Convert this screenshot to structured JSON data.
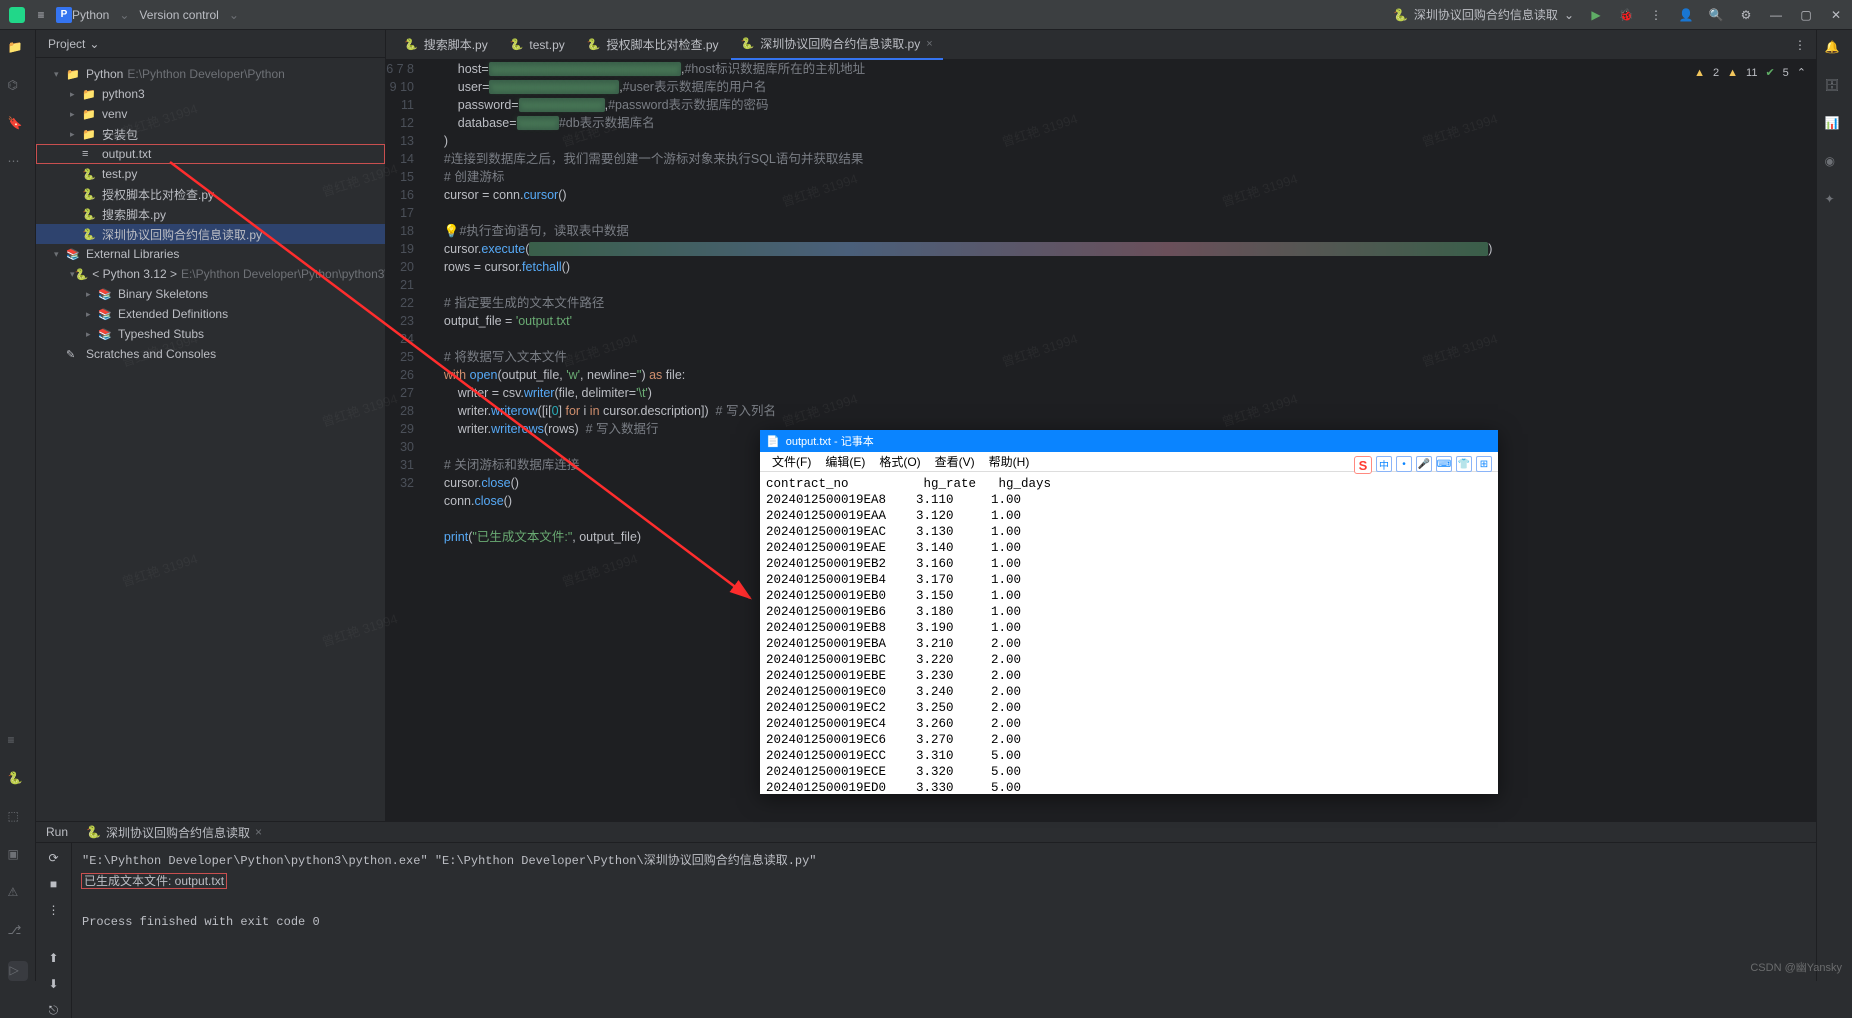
{
  "topbar": {
    "menu_icon": "≡",
    "project_badge": "P",
    "project_name": "Python",
    "vcs": "Version control",
    "run_config_icon": "▶",
    "run_config": "深圳协议回购合约信息读取",
    "icons": [
      "run",
      "debug",
      "more",
      "account",
      "search",
      "settings",
      "minimize",
      "maximize",
      "close"
    ]
  },
  "project": {
    "title": "Project",
    "tree": [
      {
        "ind": 0,
        "arrow": "▾",
        "icon": "📁",
        "label": "Python",
        "path": "E:\\Pyhthon Developer\\Python"
      },
      {
        "ind": 1,
        "arrow": "▸",
        "icon": "📁",
        "label": "python3",
        "color": "#3574f0"
      },
      {
        "ind": 1,
        "arrow": "▸",
        "icon": "📁",
        "label": "venv",
        "color": "#c88b4a"
      },
      {
        "ind": 1,
        "arrow": "▸",
        "icon": "📁",
        "label": "安装包"
      },
      {
        "ind": 1,
        "arrow": "",
        "icon": "≡",
        "label": "output.txt",
        "boxed": true
      },
      {
        "ind": 1,
        "arrow": "",
        "icon": "🐍",
        "label": "test.py"
      },
      {
        "ind": 1,
        "arrow": "",
        "icon": "🐍",
        "label": "授权脚本比对检查.py"
      },
      {
        "ind": 1,
        "arrow": "",
        "icon": "🐍",
        "label": "搜索脚本.py"
      },
      {
        "ind": 1,
        "arrow": "",
        "icon": "🐍",
        "label": "深圳协议回购合约信息读取.py",
        "sel": true
      },
      {
        "ind": 0,
        "arrow": "▾",
        "icon": "📚",
        "label": "External Libraries"
      },
      {
        "ind": 1,
        "arrow": "▾",
        "icon": "🐍",
        "label": "< Python 3.12 >",
        "path": "E:\\Pyhthon Developer\\Python\\python3\\pyth"
      },
      {
        "ind": 2,
        "arrow": "▸",
        "icon": "📚",
        "label": "Binary Skeletons"
      },
      {
        "ind": 2,
        "arrow": "▸",
        "icon": "📚",
        "label": "Extended Definitions"
      },
      {
        "ind": 2,
        "arrow": "▸",
        "icon": "📚",
        "label": "Typeshed Stubs"
      },
      {
        "ind": 0,
        "arrow": "",
        "icon": "✎",
        "label": "Scratches and Consoles"
      }
    ]
  },
  "tabs": [
    {
      "label": "搜索脚本.py"
    },
    {
      "label": "test.py"
    },
    {
      "label": "授权脚本比对检查.py"
    },
    {
      "label": "深圳协议回购合约信息读取.py",
      "active": true
    }
  ],
  "editor_status": {
    "err": "2",
    "warn": "11",
    "ok": "5"
  },
  "code_start_line": 6,
  "code_lines": [
    {
      "n": 6,
      "html": "        host=<span class='str blurred'>'xxxxxxxxxxxxxxxxxxxxxxxxxxxxxx'</span>,<span class='cm'>#host标识数据库所在的主机地址</span>"
    },
    {
      "n": 7,
      "html": "        user=<span class='str blurred'>'xxxxxxxxxxxxxxxxxxxx'</span>,<span class='cm'>#user表示数据库的用户名</span>"
    },
    {
      "n": 8,
      "html": "        password=<span class='str blurred'>'xxxxxxxxxxxxx'</span>,<span class='cm'>#password表示数据库的密码</span>"
    },
    {
      "n": 9,
      "html": "        database=<span class='str blurred'>'xxxxxx'</span><span class='cm'>#db表示数据库名</span>"
    },
    {
      "n": 10,
      "html": "    )"
    },
    {
      "n": 11,
      "html": "    <span class='cm'>#连接到数据库之后，我们需要创建一个游标对象来执行SQL语句并获取结果</span>"
    },
    {
      "n": 12,
      "html": "    <span class='cm'># 创建游标</span>"
    },
    {
      "n": 13,
      "html": "    cursor = conn.<span class='fn'>cursor</span>()"
    },
    {
      "n": 14,
      "html": ""
    },
    {
      "n": 15,
      "html": "    <span class='cm'>💡#执行查询语句，读取表中数据</span>"
    },
    {
      "n": 16,
      "html": "    cursor.<span class='fn'>execute</span>(<span class='str blurred2'>\"xxxxxxxxxxxxxxxxxxxxxxxxxxxxxxxxxxxxxxxxxxxxxxxxxxxxxxxxxxxxxxxxxxxxxxxxxxxxxxxxxxxxxxxxxxxxxxxxxxxxxxxxxxxxxxxxxxxxxxxxxxxxxxxxxxxxxxxxxxxxxxxxxxxxxxxx\"</span>)"
    },
    {
      "n": 17,
      "html": "    rows = cursor.<span class='fn'>fetchall</span>()"
    },
    {
      "n": 18,
      "html": ""
    },
    {
      "n": 19,
      "html": "    <span class='cm'># 指定要生成的文本文件路径</span>"
    },
    {
      "n": 20,
      "html": "    output_file = <span class='str'>'output.txt'</span>"
    },
    {
      "n": 21,
      "html": ""
    },
    {
      "n": 22,
      "html": "    <span class='cm'># 将数据写入文本文件</span>"
    },
    {
      "n": 23,
      "html": "    <span class='kw'>with</span> <span class='fn'>open</span>(output_file, <span class='str'>'w'</span>, newline=<span class='str'>''</span>) <span class='kw'>as</span> file:"
    },
    {
      "n": 24,
      "html": "        writer = csv.<span class='fn'>writer</span>(file, delimiter=<span class='str'>'\\t'</span>)"
    },
    {
      "n": 25,
      "html": "        writer.<span class='fn'>writerow</span>([i[<span class='num'>0</span>] <span class='kw'>for</span> i <span class='kw'>in</span> cursor.description])  <span class='cm'># 写入列名</span>"
    },
    {
      "n": 26,
      "html": "        writer.<span class='fn'>writerows</span>(rows)  <span class='cm'># 写入数据行</span>"
    },
    {
      "n": 27,
      "html": ""
    },
    {
      "n": 28,
      "html": "    <span class='cm'># 关闭游标和数据库连接</span>"
    },
    {
      "n": 29,
      "html": "    cursor.<span class='fn'>close</span>()"
    },
    {
      "n": 30,
      "html": "    conn.<span class='fn'>close</span>()"
    },
    {
      "n": 31,
      "html": ""
    },
    {
      "n": 32,
      "html": "    <span class='fn'>print</span>(<span class='str'>\"已生成文本文件:\"</span>, output_file)"
    }
  ],
  "run": {
    "title": "Run",
    "tab": "深圳协议回购合约信息读取",
    "lines": [
      "\"E:\\Pyhthon Developer\\Python\\python3\\python.exe\" \"E:\\Pyhthon Developer\\Python\\深圳协议回购合约信息读取.py\"",
      "已生成文本文件: output.txt",
      "",
      "Process finished with exit code 0"
    ]
  },
  "notepad": {
    "title": "output.txt - 记事本",
    "menu": [
      "文件(F)",
      "编辑(E)",
      "格式(O)",
      "查看(V)",
      "帮助(H)"
    ],
    "header": "contract_no          hg_rate   hg_days",
    "rows": [
      [
        "2024012500019EA8",
        "3.110",
        "1.00"
      ],
      [
        "2024012500019EAA",
        "3.120",
        "1.00"
      ],
      [
        "2024012500019EAC",
        "3.130",
        "1.00"
      ],
      [
        "2024012500019EAE",
        "3.140",
        "1.00"
      ],
      [
        "2024012500019EB2",
        "3.160",
        "1.00"
      ],
      [
        "2024012500019EB4",
        "3.170",
        "1.00"
      ],
      [
        "2024012500019EB0",
        "3.150",
        "1.00"
      ],
      [
        "2024012500019EB6",
        "3.180",
        "1.00"
      ],
      [
        "2024012500019EB8",
        "3.190",
        "1.00"
      ],
      [
        "2024012500019EBA",
        "3.210",
        "2.00"
      ],
      [
        "2024012500019EBC",
        "3.220",
        "2.00"
      ],
      [
        "2024012500019EBE",
        "3.230",
        "2.00"
      ],
      [
        "2024012500019EC0",
        "3.240",
        "2.00"
      ],
      [
        "2024012500019EC2",
        "3.250",
        "2.00"
      ],
      [
        "2024012500019EC4",
        "3.260",
        "2.00"
      ],
      [
        "2024012500019EC6",
        "3.270",
        "2.00"
      ],
      [
        "2024012500019ECC",
        "3.310",
        "5.00"
      ],
      [
        "2024012500019ECE",
        "3.320",
        "5.00"
      ],
      [
        "2024012500019ED0",
        "3.330",
        "5.00"
      ]
    ]
  },
  "watermark": "曾红艳 31994",
  "csdn": "CSDN @幽Yansky"
}
